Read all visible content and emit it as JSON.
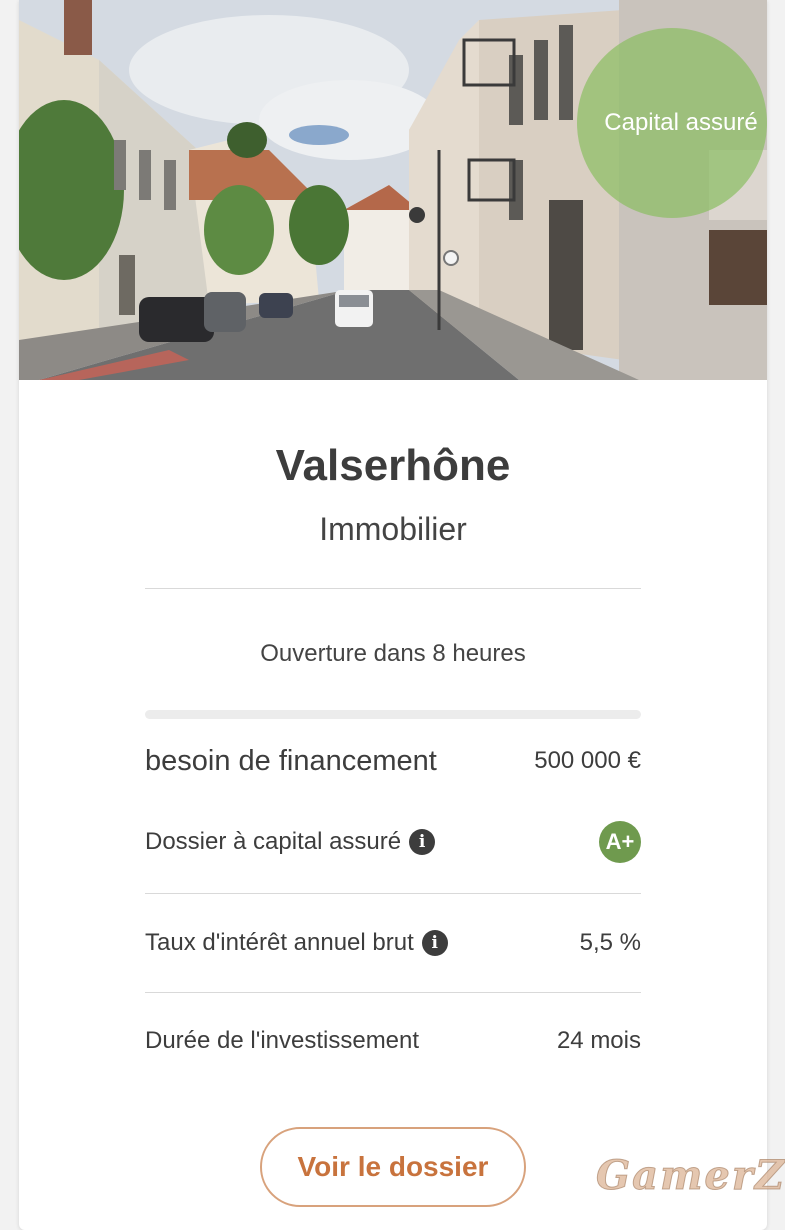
{
  "project": {
    "badge": "Capital assuré",
    "name": "Valserhône",
    "category": "Immobilier",
    "opening": "Ouverture dans 8 heures",
    "progress_fraction": 0,
    "funding_label": "besoin de financement",
    "funding_value": "500 000 €",
    "guarantee_label": "Dossier à capital assuré",
    "guarantee_grade": "A+",
    "rate_label": "Taux d'intérêt annuel brut",
    "rate_value": "5,5 %",
    "duration_label": "Durée de l'investissement",
    "duration_value": "24 mois",
    "cta": "Voir le dossier"
  },
  "icons": {
    "info": "info-icon"
  },
  "colors": {
    "accent": "#c8733d",
    "badge": "#8cbe64",
    "grade": "#6f9a4e"
  },
  "watermark": "GamerZ"
}
